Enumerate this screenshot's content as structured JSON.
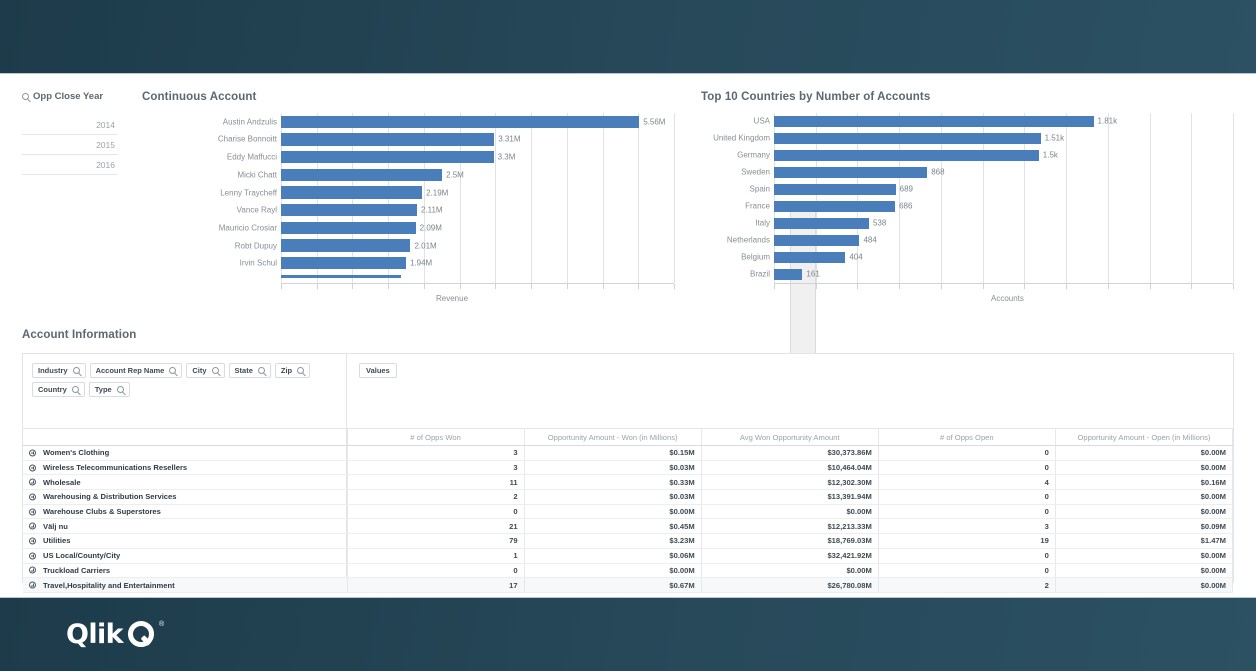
{
  "branding": {
    "logo_text": "Qlik",
    "logo_mark": "q-circle-mark",
    "registered": "®",
    "header_color": "#1d3b4a",
    "accent_color": "#4a7ebb"
  },
  "filter_pane": {
    "title": "Opp Close Year",
    "search_icon": "search-icon",
    "values": [
      "2014",
      "2015",
      "2016"
    ]
  },
  "chart_data": [
    {
      "type": "bar",
      "orientation": "horizontal",
      "title": "Continuous Account",
      "xlabel": "Revenue",
      "ylabel": "",
      "categories": [
        "Austin Andzulis",
        "Charise Bonnoitt",
        "Eddy Maffucci",
        "Micki Chatt",
        "Lenny Traycheff",
        "Vance Rayl",
        "Mauricio Crosiar",
        "Robt Dupuy",
        "Irvin Schul"
      ],
      "values": [
        5.56,
        3.31,
        3.3,
        2.5,
        2.19,
        2.11,
        2.09,
        2.01,
        1.94
      ],
      "value_labels": [
        "5.56M",
        "3.31M",
        "3.3M",
        "2.5M",
        "2.19M",
        "2.11M",
        "2.09M",
        "2.01M",
        "1.94M"
      ],
      "xlim": [
        0,
        6.1
      ],
      "grid": true,
      "gridlines": 11,
      "legend": "none",
      "has_vertical_scrollbar": true
    },
    {
      "type": "bar",
      "orientation": "horizontal",
      "title": "Top 10 Countries by Number of Accounts",
      "xlabel": "Accounts",
      "ylabel": "",
      "categories": [
        "USA",
        "United Kingdom",
        "Germany",
        "Sweden",
        "Spain",
        "France",
        "Italy",
        "Netherlands",
        "Belgium",
        "Brazil"
      ],
      "values": [
        1810,
        1510,
        1500,
        868,
        689,
        686,
        538,
        484,
        404,
        161
      ],
      "value_labels": [
        "1.81k",
        "1.51k",
        "1.5k",
        "868",
        "689",
        "686",
        "538",
        "484",
        "404",
        "161"
      ],
      "xlim": [
        0,
        2600
      ],
      "grid": true,
      "gridlines": 11,
      "legend": "none",
      "has_vertical_scrollbar": false
    }
  ],
  "account_information": {
    "title": "Account Information",
    "filter_chips": [
      {
        "label": "Industry",
        "icon": "search-icon"
      },
      {
        "label": "Account Rep Name",
        "icon": "search-icon"
      },
      {
        "label": "City",
        "icon": "search-icon"
      },
      {
        "label": "State",
        "icon": "search-icon"
      },
      {
        "label": "Zip",
        "icon": "search-icon"
      },
      {
        "label": "Country",
        "icon": "search-icon"
      },
      {
        "label": "Type",
        "icon": "search-icon"
      }
    ],
    "values_chip": "Values",
    "table": {
      "dimension_header": "",
      "columns": [
        "# of Opps Won",
        "Opportunity Amount - Won (in Millions)",
        "Avg Won Opportunity Amount",
        "# of Opps Open",
        "Opportunity Amount - Open (in Millions)"
      ],
      "rows": [
        {
          "dimension": "Women's Clothing",
          "cells": [
            "3",
            "$0.15M",
            "$30,373.86M",
            "0",
            "$0.00M"
          ]
        },
        {
          "dimension": "Wireless Telecommunications Resellers",
          "cells": [
            "3",
            "$0.03M",
            "$10,464.04M",
            "0",
            "$0.00M"
          ]
        },
        {
          "dimension": "Wholesale",
          "cells": [
            "11",
            "$0.33M",
            "$12,302.30M",
            "4",
            "$0.16M"
          ]
        },
        {
          "dimension": "Warehousing & Distribution Services",
          "cells": [
            "2",
            "$0.03M",
            "$13,391.94M",
            "0",
            "$0.00M"
          ]
        },
        {
          "dimension": "Warehouse Clubs & Superstores",
          "cells": [
            "0",
            "$0.00M",
            "$0.00M",
            "0",
            "$0.00M"
          ]
        },
        {
          "dimension": "Välj nu",
          "cells": [
            "21",
            "$0.45M",
            "$12,213.33M",
            "3",
            "$0.09M"
          ]
        },
        {
          "dimension": "Utilities",
          "cells": [
            "79",
            "$3.23M",
            "$18,769.03M",
            "19",
            "$1.47M"
          ]
        },
        {
          "dimension": "US Local/County/City",
          "cells": [
            "1",
            "$0.06M",
            "$32,421.92M",
            "0",
            "$0.00M"
          ]
        },
        {
          "dimension": "Truckload Carriers",
          "cells": [
            "0",
            "$0.00M",
            "$0.00M",
            "0",
            "$0.00M"
          ]
        },
        {
          "dimension": "Travel,Hospitality and Entertainment",
          "cells": [
            "17",
            "$0.67M",
            "$26,780.08M",
            "2",
            "$0.00M"
          ]
        }
      ]
    }
  }
}
